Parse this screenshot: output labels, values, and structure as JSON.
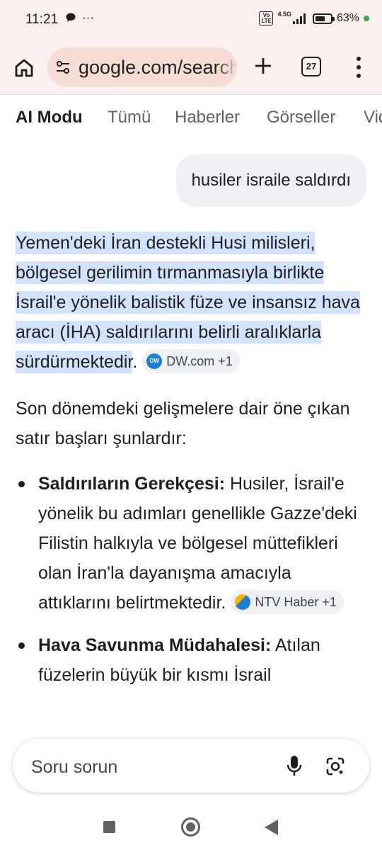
{
  "status_bar": {
    "time": "11:21",
    "notification_icons": [
      "chat-bubble-icon",
      "more-dots-icon"
    ],
    "more_glyph": "···",
    "volte_label": "Vo LTE",
    "network_type": "4.5G",
    "battery_percent": "63%",
    "battery_level": 0.63
  },
  "browser": {
    "url_text": "google.com/search",
    "tabs_count": "27"
  },
  "mode_tabs": [
    {
      "label": "AI Modu",
      "active": true
    },
    {
      "label": "Tümü",
      "active": false
    },
    {
      "label": "Haberler",
      "active": false
    },
    {
      "label": "Görseller",
      "active": false
    },
    {
      "label": "Vid",
      "active": false
    }
  ],
  "query": {
    "text": "husiler israile saldırdı"
  },
  "answer": {
    "intro_highlighted": "Yemen'deki İran destekli Husi milisleri, bölgesel gerilimin tırmanmasıyla birlikte İsrail'e yönelik balistik füze ve insansız hava aracı (İHA) saldırılarını belirli aralıklarla sürdürmektedir",
    "intro_tail": ".",
    "intro_source": "DW.com +1",
    "intro_source_logo": "DW",
    "para2": "Son dönemdeki gelişmelere dair öne çıkan satır başları şunlardır:",
    "bullets": [
      {
        "title": "Saldırıların Gerekçesi:",
        "text": " Husiler, İsrail'e yönelik bu adımları genellikle Gazze'deki Filistin halkıyla ve bölgesel müttefikleri olan İran'la dayanışma amacıyla attıklarını belirtmektedir.",
        "source": "NTV Haber +1"
      },
      {
        "title": "Hava Savunma Müdahalesi:",
        "text": " Atılan füzelerin büyük bir kısmı İsrail",
        "source": ""
      }
    ]
  },
  "ask_box": {
    "placeholder": "Soru sorun"
  },
  "colors": {
    "highlight": "#d3e3fd",
    "chrome_bg": "#fcf1ee",
    "url_pill": "#f5dcd5"
  }
}
